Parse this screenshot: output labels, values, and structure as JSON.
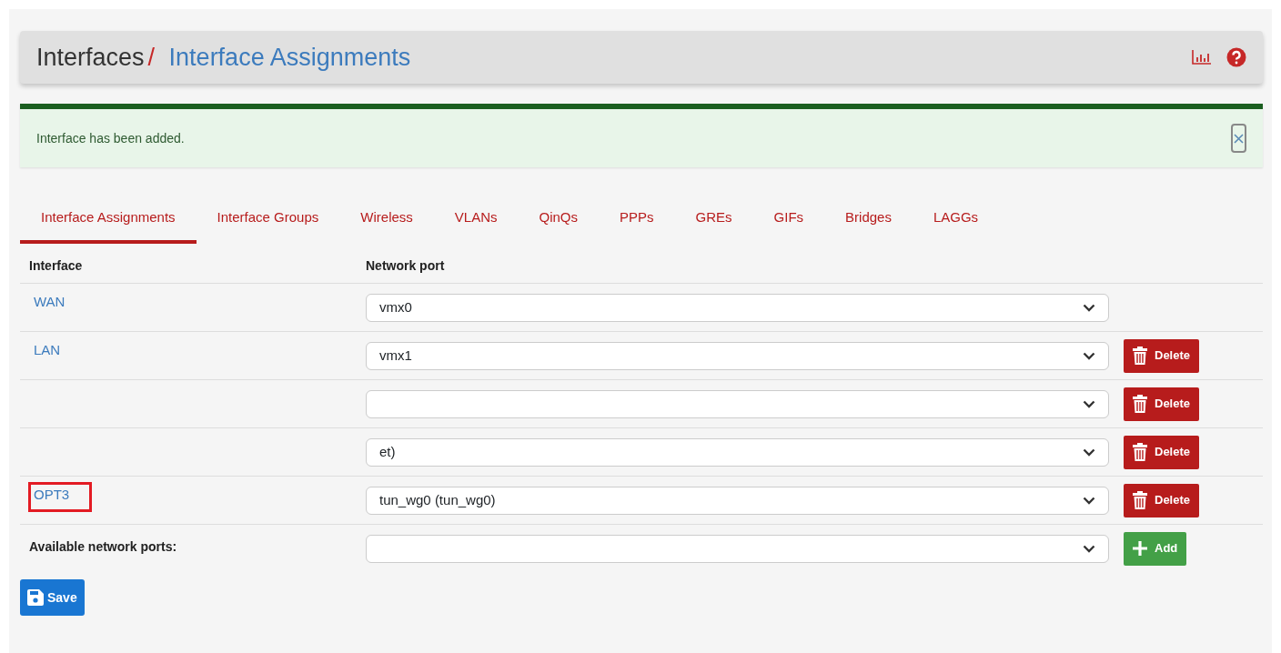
{
  "breadcrumb": {
    "parent": "Interfaces",
    "separator": "/",
    "current": "Interface Assignments"
  },
  "alert": {
    "message": "Interface has been added."
  },
  "tabs": [
    {
      "label": "Interface Assignments",
      "selected": true
    },
    {
      "label": "Interface Groups",
      "selected": false
    },
    {
      "label": "Wireless",
      "selected": false
    },
    {
      "label": "VLANs",
      "selected": false
    },
    {
      "label": "QinQs",
      "selected": false
    },
    {
      "label": "PPPs",
      "selected": false
    },
    {
      "label": "GREs",
      "selected": false
    },
    {
      "label": "GIFs",
      "selected": false
    },
    {
      "label": "Bridges",
      "selected": false
    },
    {
      "label": "LAGGs",
      "selected": false
    }
  ],
  "table": {
    "columns": [
      "Interface",
      "Network port"
    ],
    "rows": [
      {
        "name": "WAN",
        "port": "vmx0",
        "highlighted": false
      },
      {
        "name": "LAN",
        "port": "vmx1",
        "delete_label": "Delete",
        "highlighted": false
      },
      {
        "delete_label": "Delete"
      },
      {
        "port": "et)",
        "delete_label": "Delete"
      },
      {
        "name": "OPT3",
        "port": "tun_wg0 (tun_wg0)",
        "delete_label": "Delete",
        "highlighted": true
      }
    ],
    "available": {
      "label": "Available network ports:",
      "add_label": "Add"
    }
  },
  "save_label": "Save"
}
